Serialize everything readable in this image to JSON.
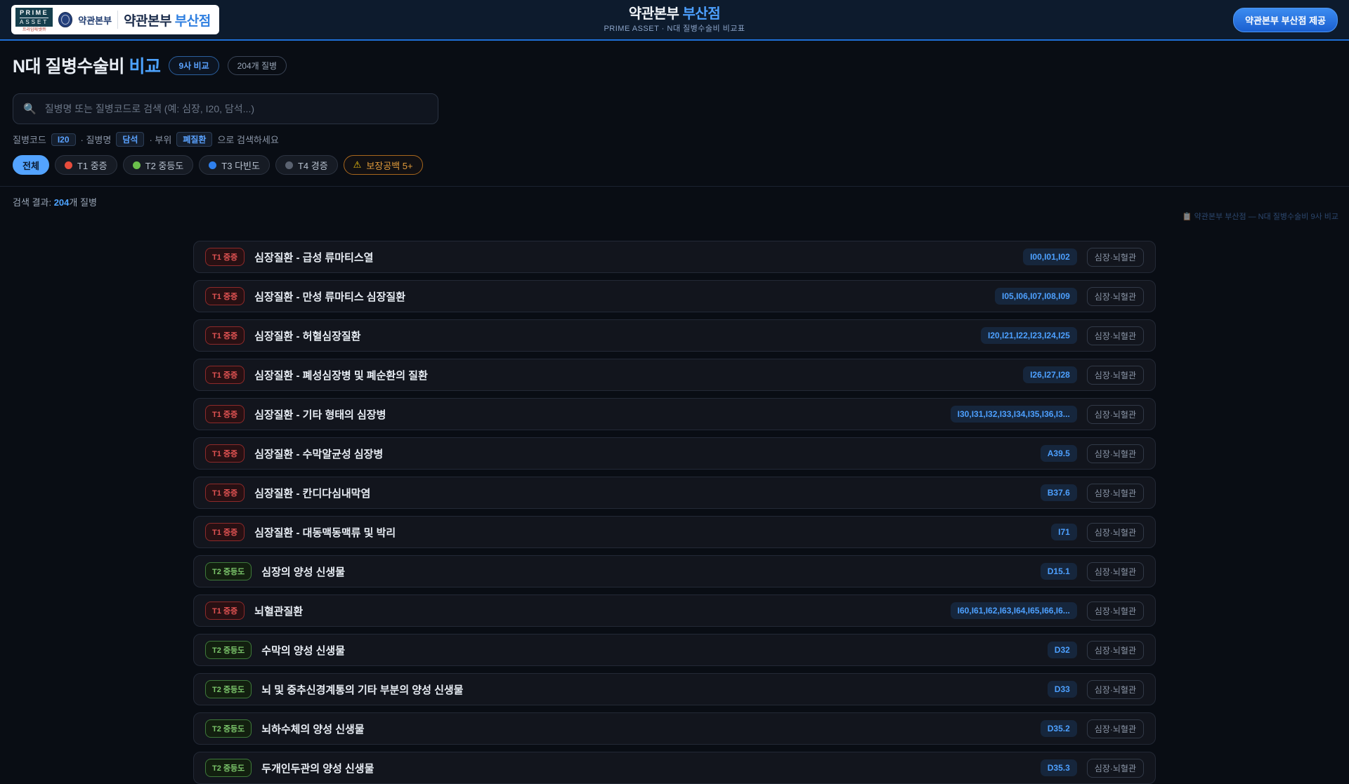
{
  "header": {
    "logo": {
      "prime_top": "PRIME",
      "prime_bottom": "ASSET",
      "prime_sub": "프라임에셋㈜",
      "emblem_label": "약관본부",
      "store_prefix": "약관본부",
      "store_branch": "부산점"
    },
    "title_prefix": "약관본부",
    "title_branch": "부산점",
    "subtitle": "PRIME ASSET · N대 질병수술비 비교표",
    "provider_button": "약관본부 부산점 제공"
  },
  "page": {
    "title_prefix": "N대 질병수술비",
    "title_accent": "비교",
    "badge_compare": "9사 비교",
    "badge_count": "204개 질병",
    "search": {
      "icon": "🔍",
      "placeholder": "질병명 또는 질병코드로 검색 (예: 심장, I20, 담석...)"
    },
    "hint": {
      "part1": "질병코드",
      "kbd1": "I20",
      "part2": "· 질병명",
      "kbd2": "담석",
      "part3": "· 부위",
      "kbd3": "폐질환",
      "part4": "으로 검색하세요"
    },
    "result": {
      "prefix": "검색 결과:",
      "count": "204",
      "suffix": "개 질병"
    },
    "watermark": "📋 약관본부 부산점 — N대 질병수술비 9사 비교"
  },
  "colors": {
    "accent_blue": "#4da3ff",
    "tier1_red": "#e74c3c",
    "tier2_green": "#6abf4b",
    "tier3_blue": "#2f80ed",
    "tier4_grey": "#5a6270",
    "warning_orange": "#e09a3a"
  },
  "filters": [
    {
      "id": "all",
      "label": "전체",
      "active": true
    },
    {
      "id": "t1",
      "label": "T1 중증",
      "dot": "#e74c3c"
    },
    {
      "id": "t2",
      "label": "T2 중등도",
      "dot": "#6abf4b"
    },
    {
      "id": "t3",
      "label": "T3 다빈도",
      "dot": "#2f80ed"
    },
    {
      "id": "t4",
      "label": "T4 경증",
      "dot": "#5a6270"
    },
    {
      "id": "gap",
      "label": "보장공백 5+",
      "warning": true,
      "icon": "⚠"
    }
  ],
  "rows": [
    {
      "tier": "t1",
      "tier_label": "T1 중증",
      "name": "심장질환 - 급성 류마티스열",
      "codes": "I00,I01,I02",
      "tag": "심장·뇌혈관"
    },
    {
      "tier": "t1",
      "tier_label": "T1 중증",
      "name": "심장질환 - 만성 류마티스 심장질환",
      "codes": "I05,I06,I07,I08,I09",
      "tag": "심장·뇌혈관"
    },
    {
      "tier": "t1",
      "tier_label": "T1 중증",
      "name": "심장질환 - 허혈심장질환",
      "codes": "I20,I21,I22,I23,I24,I25",
      "tag": "심장·뇌혈관"
    },
    {
      "tier": "t1",
      "tier_label": "T1 중증",
      "name": "심장질환 - 폐성심장병 및 폐순환의 질환",
      "codes": "I26,I27,I28",
      "tag": "심장·뇌혈관"
    },
    {
      "tier": "t1",
      "tier_label": "T1 중증",
      "name": "심장질환 - 기타 형태의 심장병",
      "codes": "I30,I31,I32,I33,I34,I35,I36,I3...",
      "tag": "심장·뇌혈관"
    },
    {
      "tier": "t1",
      "tier_label": "T1 중증",
      "name": "심장질환 - 수막알균성 심장병",
      "codes": "A39.5",
      "tag": "심장·뇌혈관"
    },
    {
      "tier": "t1",
      "tier_label": "T1 중증",
      "name": "심장질환 - 칸디다심내막염",
      "codes": "B37.6",
      "tag": "심장·뇌혈관"
    },
    {
      "tier": "t1",
      "tier_label": "T1 중증",
      "name": "심장질환 - 대동맥동맥류 및 박리",
      "codes": "I71",
      "tag": "심장·뇌혈관"
    },
    {
      "tier": "t2",
      "tier_label": "T2 중등도",
      "name": "심장의 양성 신생물",
      "codes": "D15.1",
      "tag": "심장·뇌혈관"
    },
    {
      "tier": "t1",
      "tier_label": "T1 중증",
      "name": "뇌혈관질환",
      "codes": "I60,I61,I62,I63,I64,I65,I66,I6...",
      "tag": "심장·뇌혈관"
    },
    {
      "tier": "t2",
      "tier_label": "T2 중등도",
      "name": "수막의 양성 신생물",
      "codes": "D32",
      "tag": "심장·뇌혈관"
    },
    {
      "tier": "t2",
      "tier_label": "T2 중등도",
      "name": "뇌 및 중추신경계통의 기타 부분의 양성 신생물",
      "codes": "D33",
      "tag": "심장·뇌혈관"
    },
    {
      "tier": "t2",
      "tier_label": "T2 중등도",
      "name": "뇌하수체의 양성 신생물",
      "codes": "D35.2",
      "tag": "심장·뇌혈관"
    },
    {
      "tier": "t2",
      "tier_label": "T2 중등도",
      "name": "두개인두관의 양성 신생물",
      "codes": "D35.3",
      "tag": "심장·뇌혈관"
    }
  ]
}
